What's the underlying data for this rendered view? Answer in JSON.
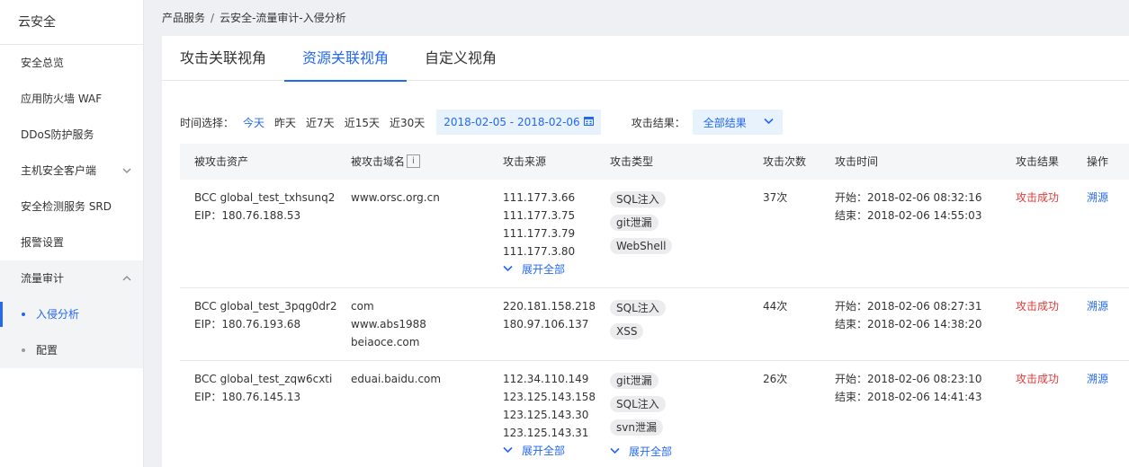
{
  "sidebar": {
    "title": "云安全",
    "items": [
      {
        "label": "安全总览"
      },
      {
        "label": "应用防火墙 WAF"
      },
      {
        "label": "DDoS防护服务"
      },
      {
        "label": "主机安全客户端"
      },
      {
        "label": "安全检测服务 SRD"
      },
      {
        "label": "报警设置"
      },
      {
        "label": "流量审计"
      }
    ],
    "sub_items": [
      {
        "label": "入侵分析"
      },
      {
        "label": "配置"
      }
    ]
  },
  "breadcrumb": {
    "root": "产品服务",
    "separator": "/",
    "current": "云安全-流量审计-入侵分析"
  },
  "tabs": [
    {
      "label": "攻击关联视角"
    },
    {
      "label": "资源关联视角"
    },
    {
      "label": "自定义视角"
    }
  ],
  "filter": {
    "time_label": "时间选择：",
    "options": [
      {
        "label": "今天"
      },
      {
        "label": "昨天"
      },
      {
        "label": "近7天"
      },
      {
        "label": "近15天"
      },
      {
        "label": "近30天"
      }
    ],
    "date_range": "2018-02-05 - 2018-02-06",
    "result_label": "攻击结果：",
    "result_value": "全部结果"
  },
  "table": {
    "headers": {
      "asset": "被攻击资产",
      "domain": "被攻击域名",
      "info_glyph": "i",
      "source": "攻击来源",
      "type": "攻击类型",
      "count": "攻击次数",
      "time": "攻击时间",
      "result": "攻击结果",
      "action": "操作"
    },
    "rows": [
      {
        "asset_name": "BCC global_test_txhsunq2",
        "asset_eip": "EIP：180.76.188.53",
        "domains": [
          "www.orsc.org.cn"
        ],
        "sources": [
          "111.177.3.66",
          "111.177.3.75",
          "111.177.3.79",
          "111.177.3.80"
        ],
        "sources_expand": "展开全部",
        "types": [
          "SQL注入",
          "git泄漏",
          "WebShell"
        ],
        "count": "37次",
        "start": "开始：2018-02-06 08:32:16",
        "end": "结束：2018-02-06 14:55:03",
        "result": "攻击成功",
        "action": "溯源"
      },
      {
        "asset_name": "BCC global_test_3pqg0dr2",
        "asset_eip": "EIP：180.76.193.68",
        "domains": [
          "com",
          "www.abs1988",
          "beiaoce.com"
        ],
        "sources": [
          "220.181.158.218",
          "180.97.106.137"
        ],
        "types": [
          "SQL注入",
          "XSS"
        ],
        "count": "44次",
        "start": "开始：2018-02-06 08:27:31",
        "end": "结束：2018-02-06 14:38:20",
        "result": "攻击成功",
        "action": "溯源"
      },
      {
        "asset_name": "BCC global_test_zqw6cxti",
        "asset_eip": "EIP：180.76.145.13",
        "domains": [
          "eduai.baidu.com"
        ],
        "sources": [
          "112.34.110.149",
          "123.125.143.158",
          "123.125.143.30",
          "123.125.143.31"
        ],
        "sources_expand": "展开全部",
        "types": [
          "git泄漏",
          "SQL注入",
          "svn泄漏"
        ],
        "types_expand": "展开全部",
        "count": "26次",
        "start": "开始：2018-02-06 08:23:10",
        "end": "结束：2018-02-06 14:41:43",
        "result": "攻击成功",
        "action": "溯源"
      }
    ]
  }
}
